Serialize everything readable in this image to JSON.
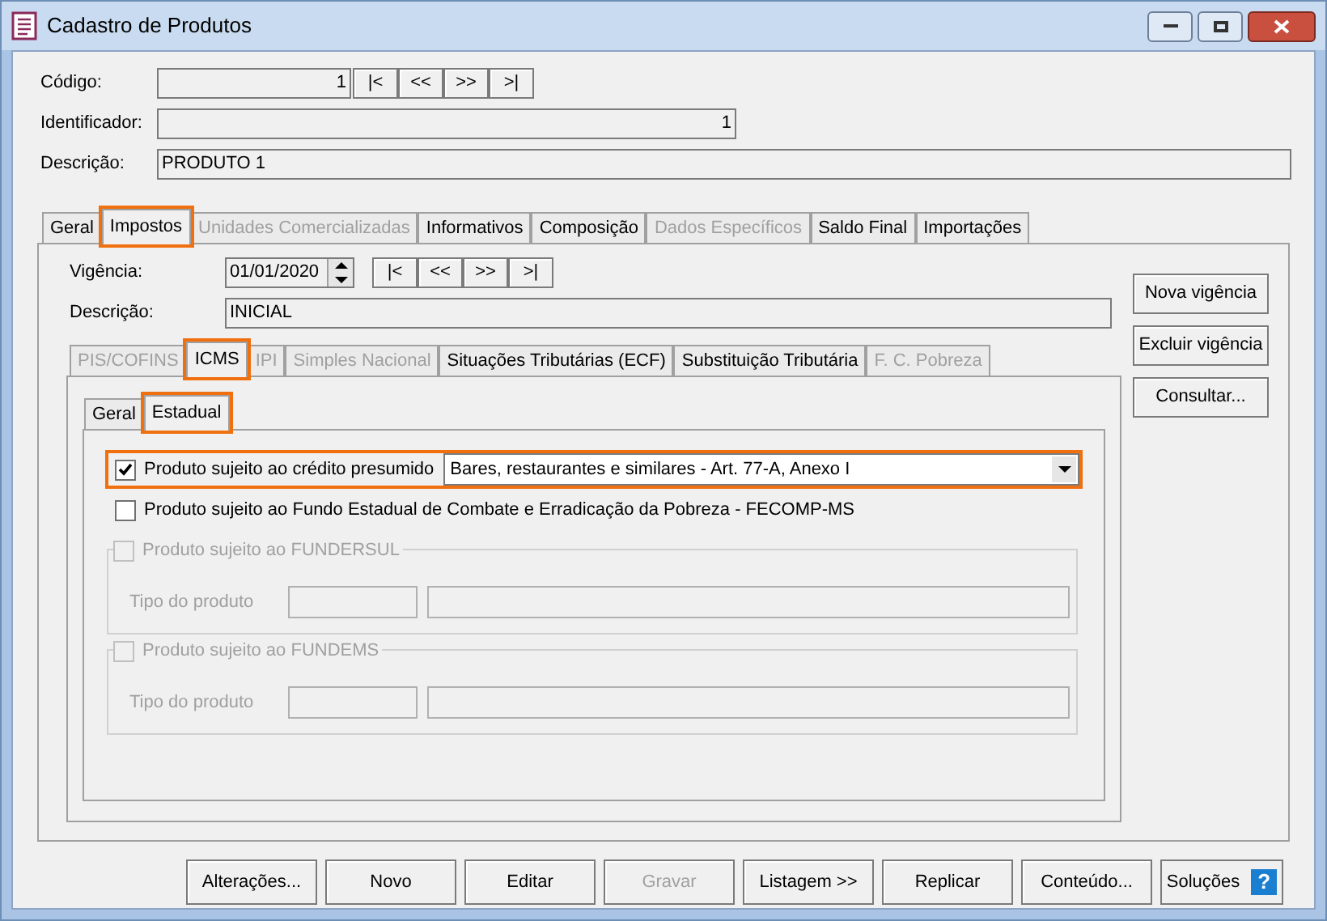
{
  "window": {
    "title": "Cadastro de Produtos"
  },
  "header_fields": [
    {
      "label": "Código:",
      "value": "1",
      "nav": [
        "|<",
        "<<",
        ">>",
        ">|"
      ]
    },
    {
      "label": "Identificador:",
      "value": "1"
    },
    {
      "label": "Descrição:",
      "value": "PRODUTO 1"
    }
  ],
  "tabs": [
    {
      "label": "Geral",
      "selected": false,
      "disabled": false,
      "highlighted": false
    },
    {
      "label": "Impostos",
      "selected": true,
      "disabled": false,
      "highlighted": true
    },
    {
      "label": "Unidades Comercializadas",
      "selected": false,
      "disabled": true,
      "highlighted": false
    },
    {
      "label": "Informativos",
      "selected": false,
      "disabled": false,
      "highlighted": false
    },
    {
      "label": "Composição",
      "selected": false,
      "disabled": false,
      "highlighted": false
    },
    {
      "label": "Dados Específicos",
      "selected": false,
      "disabled": true,
      "highlighted": false
    },
    {
      "label": "Saldo Final",
      "selected": false,
      "disabled": false,
      "highlighted": false
    },
    {
      "label": "Importações",
      "selected": false,
      "disabled": false,
      "highlighted": false
    }
  ],
  "vigencia": {
    "label": "Vigência:",
    "value": "01/01/2020",
    "nav": [
      "|<",
      "<<",
      ">>",
      ">|"
    ]
  },
  "descricao": {
    "label": "Descrição:",
    "value": "INICIAL"
  },
  "side_buttons": [
    "Nova vigência",
    "Excluir vigência",
    "Consultar..."
  ],
  "sub_tabs": [
    {
      "label": "PIS/COFINS",
      "selected": false,
      "disabled": true,
      "highlighted": false
    },
    {
      "label": "ICMS",
      "selected": true,
      "disabled": false,
      "highlighted": true
    },
    {
      "label": "IPI",
      "selected": false,
      "disabled": true,
      "highlighted": false
    },
    {
      "label": "Simples Nacional",
      "selected": false,
      "disabled": true,
      "highlighted": false
    },
    {
      "label": "Situações Tributárias (ECF)",
      "selected": false,
      "disabled": false,
      "highlighted": false
    },
    {
      "label": "Substituição Tributária",
      "selected": false,
      "disabled": false,
      "highlighted": false
    },
    {
      "label": "F. C. Pobreza",
      "selected": false,
      "disabled": true,
      "highlighted": false
    }
  ],
  "inner_tabs": [
    {
      "label": "Geral",
      "selected": false,
      "disabled": false,
      "highlighted": false
    },
    {
      "label": "Estadual",
      "selected": true,
      "disabled": false,
      "highlighted": true
    }
  ],
  "options": [
    {
      "kind": "checkbox_combo",
      "label": "Produto sujeito ao crédito presumido",
      "checked": true,
      "highlighted": true,
      "value": "Bares, restaurantes e similares - Art. 77-A, Anexo I"
    },
    {
      "kind": "checkbox",
      "label": "Produto sujeito ao Fundo Estadual de Combate e Erradicação da Pobreza - FECOMP-MS",
      "checked": false,
      "highlighted": false
    }
  ],
  "groups": [
    {
      "label": "Produto sujeito ao FUNDERSUL",
      "checked": false,
      "disabled": true,
      "field_label": "Tipo do produto"
    },
    {
      "label": "Produto sujeito ao FUNDEMS",
      "checked": false,
      "disabled": true,
      "field_label": "Tipo do produto"
    }
  ],
  "buttons": [
    {
      "label": "Alterações...",
      "disabled": false
    },
    {
      "label": "Novo",
      "disabled": false
    },
    {
      "label": "Editar",
      "disabled": false
    },
    {
      "label": "Gravar",
      "disabled": true
    },
    {
      "label": "Listagem >>",
      "disabled": false
    },
    {
      "label": "Replicar",
      "disabled": false
    },
    {
      "label": "Conteúdo...",
      "disabled": false
    }
  ],
  "help_button": {
    "label": "Soluções",
    "icon": "?"
  }
}
